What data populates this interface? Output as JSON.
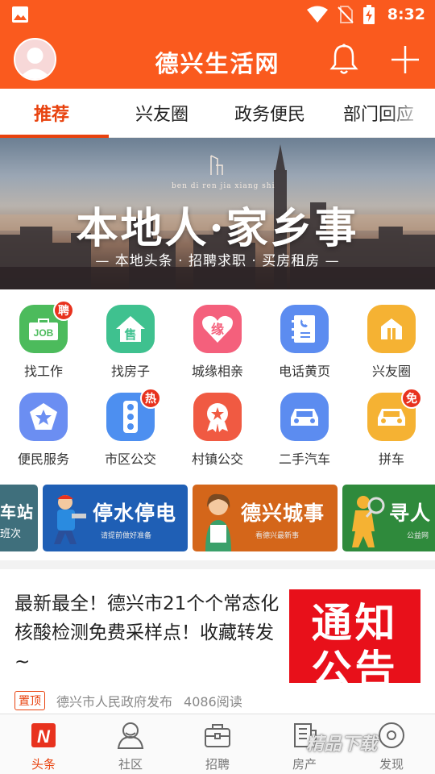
{
  "status_bar": {
    "time": "8:32"
  },
  "header": {
    "title": "德兴生活网"
  },
  "tabs": [
    {
      "label": "推荐",
      "active": true
    },
    {
      "label": "兴友圈"
    },
    {
      "label": "政务便民"
    },
    {
      "label": "部门回应"
    }
  ],
  "banner": {
    "pinyin": "ben di ren jia xiang shi",
    "title": "本地人·家乡事",
    "subtitle": "— 本地头条 · 招聘求职 · 买房租房 —"
  },
  "grid": [
    {
      "label": "找工作",
      "icon": "job-icon",
      "glyph": "JOB",
      "color": "#4cbb5c",
      "badge": "聘"
    },
    {
      "label": "找房子",
      "icon": "house-icon",
      "glyph": "售",
      "color": "#3fc18f",
      "badge": ""
    },
    {
      "label": "城缘相亲",
      "icon": "heart-icon",
      "glyph": "缘",
      "color": "#f4607c",
      "badge": ""
    },
    {
      "label": "电话黄页",
      "icon": "phonebook-icon",
      "glyph": "☏",
      "color": "#5c8cf0",
      "badge": ""
    },
    {
      "label": "兴友圈",
      "icon": "community-icon",
      "glyph": "⌂",
      "color": "#f5b233",
      "badge": ""
    },
    {
      "label": "便民服务",
      "icon": "star-service-icon",
      "glyph": "★",
      "color": "#6b8ef2",
      "badge": ""
    },
    {
      "label": "市区公交",
      "icon": "traffic-light-icon",
      "glyph": "●",
      "color": "#4d8ff0",
      "badge": "热"
    },
    {
      "label": "村镇公交",
      "icon": "medal-icon",
      "glyph": "★",
      "color": "#f05a42",
      "badge": ""
    },
    {
      "label": "二手汽车",
      "icon": "car-icon",
      "glyph": "🚗",
      "color": "#5c8cf0",
      "badge": ""
    },
    {
      "label": "拼车",
      "icon": "carpool-icon",
      "glyph": "🚗",
      "color": "#f5b233",
      "badge": "免"
    }
  ],
  "promos": [
    {
      "title": "车站",
      "subtitle": "班次",
      "color": "#3f6f7c"
    },
    {
      "title": "停水停电",
      "subtitle": "请提前做好准备",
      "color": "#1f5fb5"
    },
    {
      "title": "德兴城事",
      "subtitle": "看德兴最新事",
      "color": "#d4661a"
    },
    {
      "title": "寻人",
      "subtitle": "公益网",
      "color": "#2f8a3c"
    }
  ],
  "news": {
    "title": "最新最全！德兴市21个个常态化核酸检测免费采样点！收藏转发~",
    "pin_label": "置顶",
    "source": "德兴市人民政府发布",
    "reads": "4086阅读",
    "thumb_line1": "通知",
    "thumb_line2": "公告"
  },
  "bottom_nav": [
    {
      "label": "头条",
      "active": true
    },
    {
      "label": "社区"
    },
    {
      "label": "招聘"
    },
    {
      "label": "房产"
    },
    {
      "label": "发现"
    }
  ],
  "watermark": "精品下载"
}
